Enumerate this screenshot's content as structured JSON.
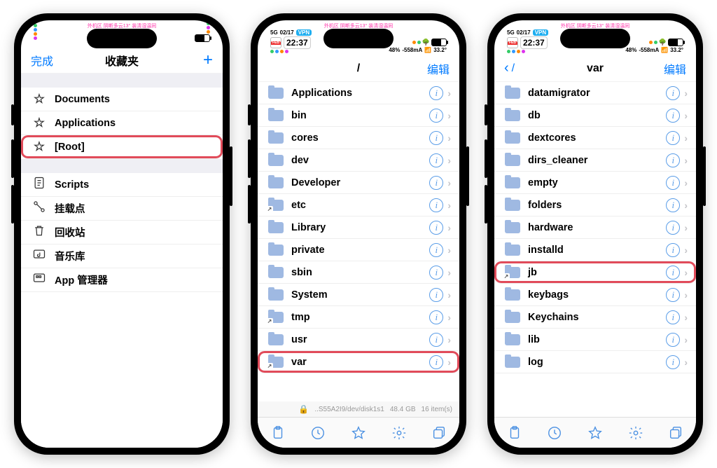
{
  "status": {
    "time": "22:37",
    "date": "02/17",
    "carrier_ticker": "外机区 阴断多云13° 装清湿温同",
    "battery_text": "48%",
    "current_ma": "-558mA",
    "temp": "33.2°"
  },
  "phone1": {
    "nav": {
      "left": "完成",
      "title": "收藏夹",
      "right_icon": "plus"
    },
    "groups": [
      {
        "items": [
          {
            "icon": "star",
            "label": "Documents",
            "interact": true,
            "hl": false
          },
          {
            "icon": "star",
            "label": "Applications",
            "interact": true,
            "hl": false
          },
          {
            "icon": "star",
            "label": "[Root]",
            "interact": true,
            "hl": true
          }
        ]
      },
      {
        "items": [
          {
            "icon": "script",
            "label": "Scripts",
            "interact": true
          },
          {
            "icon": "mount",
            "label": "挂载点",
            "interact": true
          },
          {
            "icon": "trash",
            "label": "回收站",
            "interact": true
          },
          {
            "icon": "music",
            "label": "音乐库",
            "interact": true
          },
          {
            "icon": "apps",
            "label": "App 管理器",
            "interact": true
          }
        ]
      }
    ]
  },
  "phone2": {
    "nav": {
      "title": "/",
      "right": "编辑"
    },
    "items": [
      {
        "label": "Applications",
        "alias": false
      },
      {
        "label": "bin",
        "alias": false
      },
      {
        "label": "cores",
        "alias": false
      },
      {
        "label": "dev",
        "alias": false
      },
      {
        "label": "Developer",
        "alias": false
      },
      {
        "label": "etc",
        "alias": true
      },
      {
        "label": "Library",
        "alias": false
      },
      {
        "label": "private",
        "alias": false
      },
      {
        "label": "sbin",
        "alias": false
      },
      {
        "label": "System",
        "alias": false
      },
      {
        "label": "tmp",
        "alias": true
      },
      {
        "label": "usr",
        "alias": false
      },
      {
        "label": "var",
        "alias": true,
        "hl": true
      }
    ],
    "footer": {
      "path": "..S55A2I9/dev/disk1s1",
      "size": "48.4 GB",
      "count": "16 item(s)"
    }
  },
  "phone3": {
    "nav": {
      "back": "/",
      "title": "var",
      "right": "编辑"
    },
    "items": [
      {
        "label": "datamigrator"
      },
      {
        "label": "db"
      },
      {
        "label": "dextcores"
      },
      {
        "label": "dirs_cleaner"
      },
      {
        "label": "empty"
      },
      {
        "label": "folders"
      },
      {
        "label": "hardware"
      },
      {
        "label": "installd"
      },
      {
        "label": "jb",
        "alias": true,
        "hl": true
      },
      {
        "label": "keybags"
      },
      {
        "label": "Keychains"
      },
      {
        "label": "lib"
      },
      {
        "label": "log"
      }
    ]
  },
  "toolbar_icons": [
    "clipboard",
    "clock",
    "star",
    "gear",
    "windows"
  ]
}
